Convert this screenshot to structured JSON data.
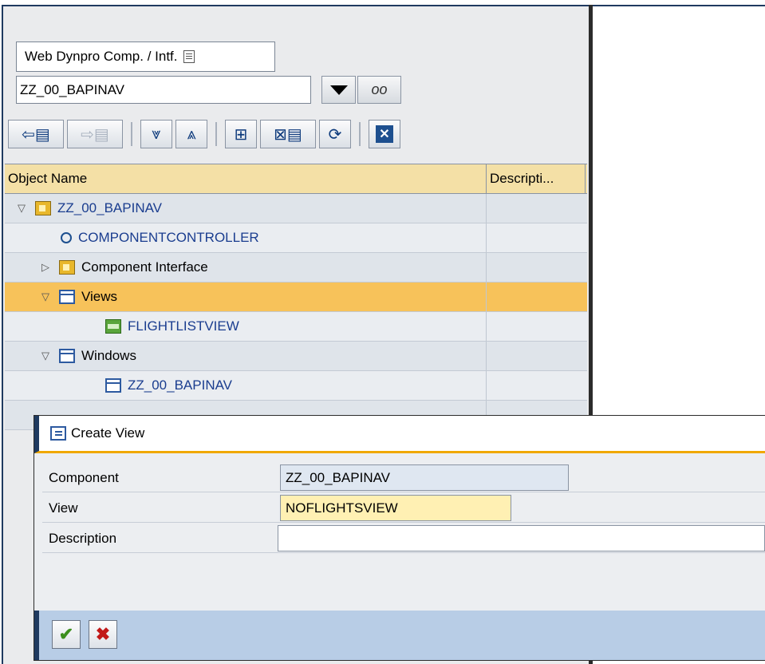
{
  "object_selector": {
    "type_label": "Web Dynpro Comp. / Intf.",
    "name_value": "ZZ_00_BAPINAV"
  },
  "toolbar": {
    "icons": [
      "back-icon",
      "forward-icon",
      "expand-all-icon",
      "collapse-all-icon",
      "hierarchy-icon",
      "display-object-list-icon",
      "refresh-icon",
      "close-icon"
    ]
  },
  "tree": {
    "columns": [
      "Object Name",
      "Descripti..."
    ],
    "rows": [
      {
        "label": "ZZ_00_BAPINAV",
        "expander": "▽",
        "icon": "component-icon"
      },
      {
        "label": "COMPONENTCONTROLLER",
        "expander": "",
        "icon": "controller-icon"
      },
      {
        "label": "Component Interface",
        "expander": "▷",
        "icon": "component-icon"
      },
      {
        "label": "Views",
        "expander": "▽",
        "icon": "window-icon"
      },
      {
        "label": "FLIGHTLISTVIEW",
        "expander": "",
        "icon": "view-icon"
      },
      {
        "label": "Windows",
        "expander": "▽",
        "icon": "window-icon"
      },
      {
        "label": "ZZ_00_BAPINAV",
        "expander": "",
        "icon": "window-icon"
      }
    ]
  },
  "dialog": {
    "title": "Create View",
    "fields": [
      {
        "label": "Component",
        "value": "ZZ_00_BAPINAV"
      },
      {
        "label": "View",
        "value": "NOFLIGHTSVIEW"
      },
      {
        "label": "Description",
        "value": ""
      }
    ],
    "ok_symbol": "✔",
    "cancel_symbol": "✖"
  },
  "colors": {
    "header_bg": "#f4e0a6",
    "selected_row": "#f7c25a",
    "link_text": "#1a3d8f",
    "dialog_footer": "#b8cde6"
  }
}
